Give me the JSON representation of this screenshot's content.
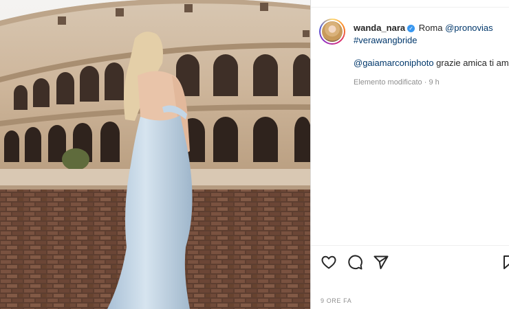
{
  "post": {
    "username": "wanda_nara",
    "location": "Roma",
    "mention_brand": "@pronovias",
    "hashtag": "#verawangbride",
    "comment_mention": "@gaiamarconiphoto",
    "comment_text": "grazie amica ti am",
    "edited_label": "Elemento modificato",
    "edited_time": "9 h",
    "timestamp": "9 ORE FA"
  },
  "icons": {
    "verified": "verified-badge-icon",
    "like": "heart-icon",
    "comment": "comment-icon",
    "share": "paper-plane-icon",
    "save": "bookmark-icon"
  },
  "colors": {
    "link": "#00376b",
    "verified": "#3897f0",
    "muted": "#8e8e8e",
    "dress": "#b9cfe2"
  }
}
